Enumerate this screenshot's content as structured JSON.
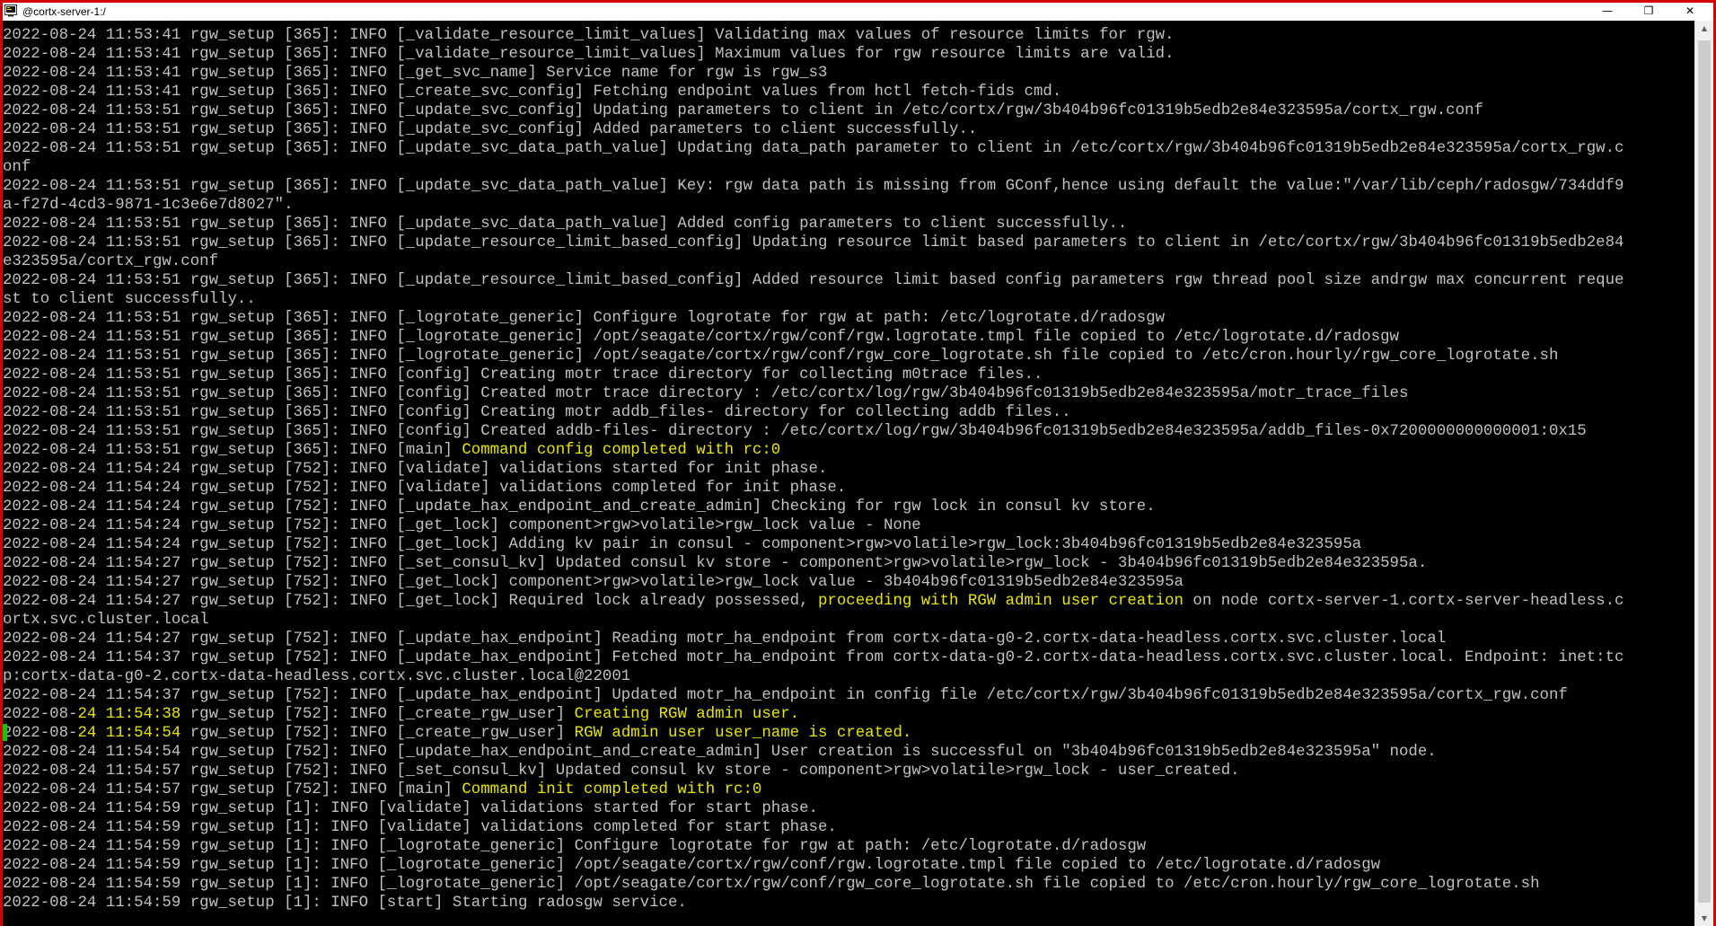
{
  "window": {
    "title": "@cortx-server-1:/",
    "controls": {
      "minimize": "—",
      "maximize": "❐",
      "close": "✕"
    },
    "border_color": "#d40000"
  },
  "colors": {
    "background": "#000000",
    "text": "#c0c0c0",
    "highlight": "#e8e400",
    "cursor": "#00cc00"
  },
  "scrollbar": {
    "up": "▲",
    "down": "▼"
  },
  "log": [
    {
      "a": "2022-08-24 11:53:41 rgw_setup [365]: INFO [_validate_resource_limit_values] Validating max values of resource limits for rgw."
    },
    {
      "a": "2022-08-24 11:53:41 rgw_setup [365]: INFO [_validate_resource_limit_values] Maximum values for rgw resource limits are valid."
    },
    {
      "a": "2022-08-24 11:53:41 rgw_setup [365]: INFO [_get_svc_name] Service name for rgw is rgw_s3"
    },
    {
      "a": "2022-08-24 11:53:41 rgw_setup [365]: INFO [_create_svc_config] Fetching endpoint values from hctl fetch-fids cmd."
    },
    {
      "a": "2022-08-24 11:53:51 rgw_setup [365]: INFO [_update_svc_config] Updating parameters to client in /etc/cortx/rgw/3b404b96fc01319b5edb2e84e323595a/cortx_rgw.conf"
    },
    {
      "a": "2022-08-24 11:53:51 rgw_setup [365]: INFO [_update_svc_config] Added parameters to client successfully.."
    },
    {
      "a": "2022-08-24 11:53:51 rgw_setup [365]: INFO [_update_svc_data_path_value] Updating data_path parameter to client in /etc/cortx/rgw/3b404b96fc01319b5edb2e84e323595a/cortx_rgw.c"
    },
    {
      "a": "onf"
    },
    {
      "a": "2022-08-24 11:53:51 rgw_setup [365]: INFO [_update_svc_data_path_value] Key: rgw data path is missing from GConf,hence using default the value:\"/var/lib/ceph/radosgw/734ddf9"
    },
    {
      "a": "a-f27d-4cd3-9871-1c3e6e7d8027\"."
    },
    {
      "a": "2022-08-24 11:53:51 rgw_setup [365]: INFO [_update_svc_data_path_value] Added config parameters to client successfully.."
    },
    {
      "a": "2022-08-24 11:53:51 rgw_setup [365]: INFO [_update_resource_limit_based_config] Updating resource limit based parameters to client in /etc/cortx/rgw/3b404b96fc01319b5edb2e84"
    },
    {
      "a": "e323595a/cortx_rgw.conf"
    },
    {
      "a": "2022-08-24 11:53:51 rgw_setup [365]: INFO [_update_resource_limit_based_config] Added resource limit based config parameters rgw thread pool size andrgw max concurrent reque"
    },
    {
      "a": "st to client successfully.."
    },
    {
      "a": "2022-08-24 11:53:51 rgw_setup [365]: INFO [_logrotate_generic] Configure logrotate for rgw at path: /etc/logrotate.d/radosgw"
    },
    {
      "a": "2022-08-24 11:53:51 rgw_setup [365]: INFO [_logrotate_generic] /opt/seagate/cortx/rgw/conf/rgw.logrotate.tmpl file copied to /etc/logrotate.d/radosgw"
    },
    {
      "a": "2022-08-24 11:53:51 rgw_setup [365]: INFO [_logrotate_generic] /opt/seagate/cortx/rgw/conf/rgw_core_logrotate.sh file copied to /etc/cron.hourly/rgw_core_logrotate.sh"
    },
    {
      "a": "2022-08-24 11:53:51 rgw_setup [365]: INFO [config] Creating motr trace directory for collecting m0trace files.."
    },
    {
      "a": "2022-08-24 11:53:51 rgw_setup [365]: INFO [config] Created motr trace directory : /etc/cortx/log/rgw/3b404b96fc01319b5edb2e84e323595a/motr_trace_files"
    },
    {
      "a": "2022-08-24 11:53:51 rgw_setup [365]: INFO [config] Creating motr addb_files- directory for collecting addb files.."
    },
    {
      "a": "2022-08-24 11:53:51 rgw_setup [365]: INFO [config] Created addb-files- directory : /etc/cortx/log/rgw/3b404b96fc01319b5edb2e84e323595a/addb_files-0x7200000000000001:0x15"
    },
    {
      "a": "2022-08-24 11:53:51 rgw_setup [365]: INFO [main] ",
      "h": "Command config completed with rc:0"
    },
    {
      "a": "2022-08-24 11:54:24 rgw_setup [752]: INFO [validate] validations started for init phase."
    },
    {
      "a": "2022-08-24 11:54:24 rgw_setup [752]: INFO [validate] validations completed for init phase."
    },
    {
      "a": "2022-08-24 11:54:24 rgw_setup [752]: INFO [_update_hax_endpoint_and_create_admin] Checking for rgw lock in consul kv store."
    },
    {
      "a": "2022-08-24 11:54:24 rgw_setup [752]: INFO [_get_lock] component>rgw>volatile>rgw_lock value - None"
    },
    {
      "a": "2022-08-24 11:54:24 rgw_setup [752]: INFO [_get_lock] Adding kv pair in consul - component>rgw>volatile>rgw_lock:3b404b96fc01319b5edb2e84e323595a"
    },
    {
      "a": "2022-08-24 11:54:27 rgw_setup [752]: INFO [_set_consul_kv] Updated consul kv store - component>rgw>volatile>rgw_lock - 3b404b96fc01319b5edb2e84e323595a."
    },
    {
      "a": "2022-08-24 11:54:27 rgw_setup [752]: INFO [_get_lock] component>rgw>volatile>rgw_lock value - 3b404b96fc01319b5edb2e84e323595a"
    },
    {
      "a": "2022-08-24 11:54:27 rgw_setup [752]: INFO [_get_lock] Required lock already possessed, ",
      "h": "proceeding with RGW admin user creation",
      "b": " on node cortx-server-1.cortx-server-headless.c"
    },
    {
      "a": "ortx.svc.cluster.local"
    },
    {
      "a": "2022-08-24 11:54:27 rgw_setup [752]: INFO [_update_hax_endpoint] Reading motr_ha_endpoint from cortx-data-g0-2.cortx-data-headless.cortx.svc.cluster.local"
    },
    {
      "a": "2022-08-24 11:54:37 rgw_setup [752]: INFO [_update_hax_endpoint] Fetched motr_ha_endpoint from cortx-data-g0-2.cortx-data-headless.cortx.svc.cluster.local. Endpoint: inet:tc"
    },
    {
      "a": "p:cortx-data-g0-2.cortx-data-headless.cortx.svc.cluster.local@22001"
    },
    {
      "a": "2022-08-24 11:54:37 rgw_setup [752]: INFO [_update_hax_endpoint] Updated motr_ha_endpoint in config file /etc/cortx/rgw/3b404b96fc01319b5edb2e84e323595a/cortx_rgw.conf"
    },
    {
      "a": "2022-08-",
      "h": "24 11:54:38",
      "b": " rgw_setup [752]: INFO [_create_rgw_user] ",
      "h2": "Creating RGW admin user."
    },
    {
      "c": true,
      "a": "2022-08-",
      "h": "24 11:54:54",
      "b": " rgw_setup [752]: INFO [_create_rgw_user] ",
      "h2": "RGW admin user user_name is created."
    },
    {
      "a": "2022-08-24 11:54:54 rgw_setup [752]: INFO [_update_hax_endpoint_and_create_admin] User creation is successful on \"3b404b96fc01319b5edb2e84e323595a\" node."
    },
    {
      "a": "2022-08-24 11:54:57 rgw_setup [752]: INFO [_set_consul_kv] Updated consul kv store - component>rgw>volatile>rgw_lock - user_created."
    },
    {
      "a": "2022-08-24 11:54:57 rgw_setup [752]: INFO [main] ",
      "h": "Command init completed with rc:0"
    },
    {
      "a": "2022-08-24 11:54:59 rgw_setup [1]: INFO [validate] validations started for start phase."
    },
    {
      "a": "2022-08-24 11:54:59 rgw_setup [1]: INFO [validate] validations completed for start phase."
    },
    {
      "a": "2022-08-24 11:54:59 rgw_setup [1]: INFO [_logrotate_generic] Configure logrotate for rgw at path: /etc/logrotate.d/radosgw"
    },
    {
      "a": "2022-08-24 11:54:59 rgw_setup [1]: INFO [_logrotate_generic] /opt/seagate/cortx/rgw/conf/rgw.logrotate.tmpl file copied to /etc/logrotate.d/radosgw"
    },
    {
      "a": "2022-08-24 11:54:59 rgw_setup [1]: INFO [_logrotate_generic] /opt/seagate/cortx/rgw/conf/rgw_core_logrotate.sh file copied to /etc/cron.hourly/rgw_core_logrotate.sh"
    },
    {
      "a": "2022-08-24 11:54:59 rgw_setup [1]: INFO [start] Starting radosgw service."
    }
  ]
}
